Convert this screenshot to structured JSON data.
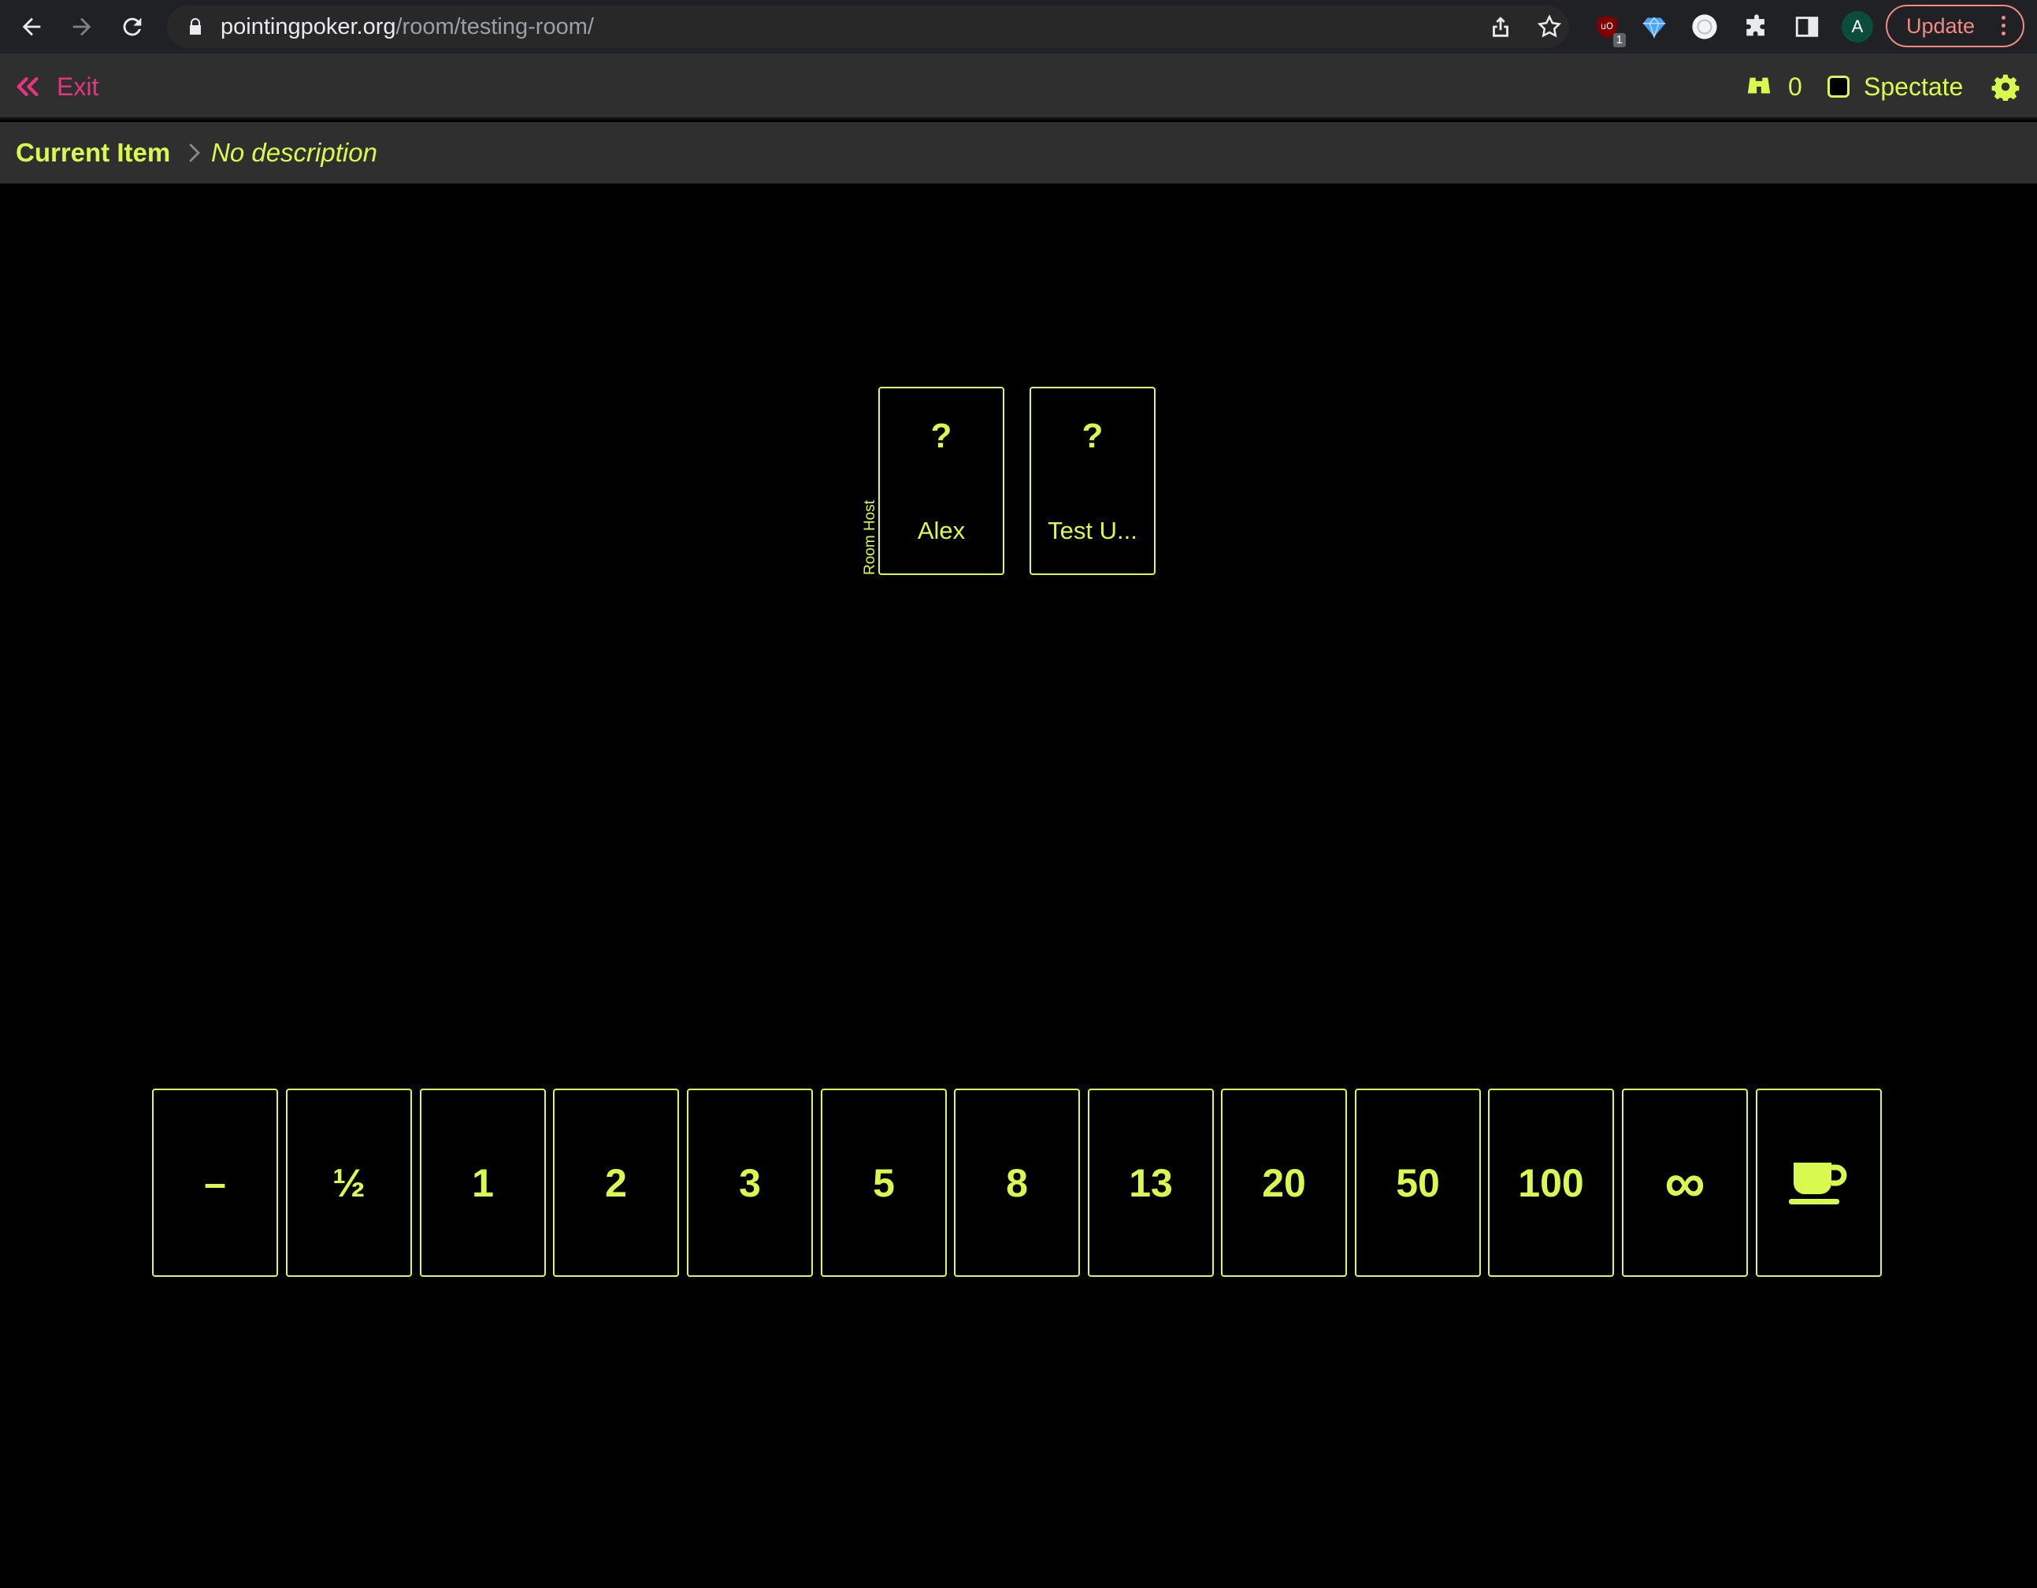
{
  "browser": {
    "url_domain": "pointingpoker.org",
    "url_path": "/room/testing-room/",
    "ublock_count": "1",
    "profile_initial": "A",
    "update_label": "Update"
  },
  "header": {
    "exit_label": "Exit",
    "spectator_count": "0",
    "spectate_label": "Spectate"
  },
  "breadcrumb": {
    "title": "Current Item",
    "description": "No description"
  },
  "players": [
    {
      "name": "Alex",
      "vote": "?",
      "tag": "Room Host"
    },
    {
      "name": "Test U...",
      "vote": "?"
    }
  ],
  "deck": [
    "–",
    "½",
    "1",
    "2",
    "3",
    "5",
    "8",
    "13",
    "20",
    "50",
    "100",
    "∞",
    "coffee-icon"
  ],
  "colors": {
    "accent": "#d8f94e",
    "exit": "#e8347f",
    "background": "#000000",
    "header": "#2f2f2f"
  }
}
